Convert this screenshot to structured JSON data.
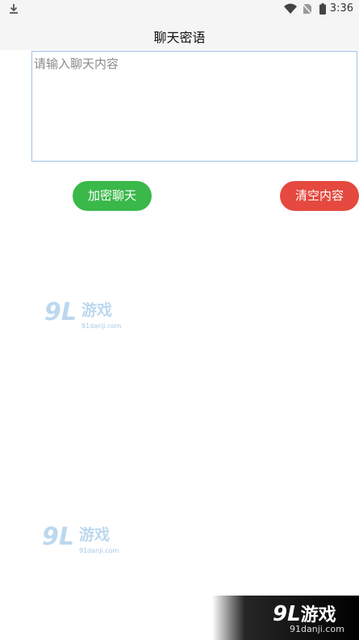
{
  "status_bar": {
    "time": "3:36",
    "icons": [
      "download-icon",
      "wifi-icon",
      "no-sim-icon",
      "battery-icon"
    ]
  },
  "app_bar": {
    "title": "聊天密语"
  },
  "chat_input": {
    "placeholder": "请输入聊天内容",
    "value": ""
  },
  "buttons": {
    "encrypt_label": "加密聊天",
    "clear_label": "清空内容"
  },
  "colors": {
    "encrypt_button": "#3bb84a",
    "clear_button": "#e5493f",
    "input_border": "#9fc1e6",
    "bars": "#f5f5f5"
  },
  "watermarks": {
    "brand_number": "9L",
    "brand_name": "游戏",
    "url": "91danji.com"
  }
}
